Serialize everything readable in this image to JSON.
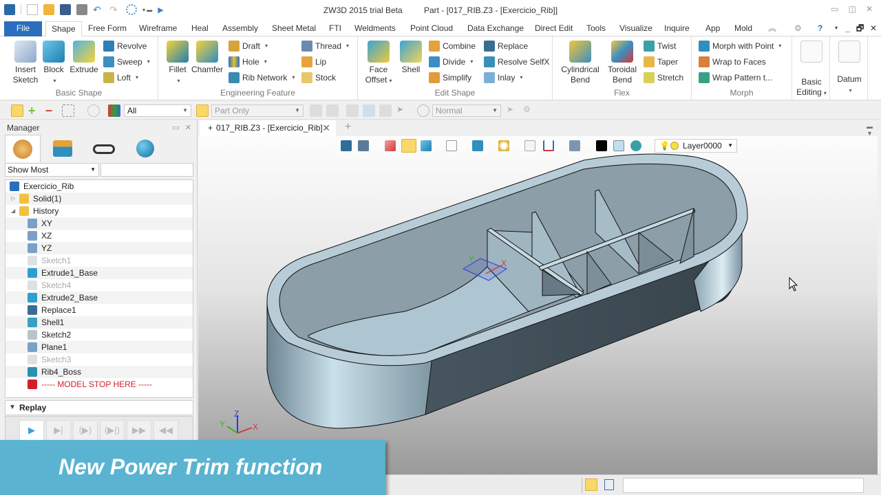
{
  "window": {
    "app_title": "ZW3D 2015 trial Beta",
    "doc_title": "Part - [017_RIB.Z3 - [Exercicio_Rib]]",
    "controls": [
      "minimize",
      "restore",
      "close"
    ]
  },
  "quick_access": [
    "app-logo-icon",
    "new-icon",
    "open-icon",
    "save-icon",
    "print-icon",
    "undo-icon",
    "redo-icon",
    "cycle-icon",
    "customize-icon",
    "play-icon"
  ],
  "ribbon_tabs": [
    "File",
    "Shape",
    "Free Form",
    "Wireframe",
    "Heal",
    "Assembly",
    "Sheet Metal",
    "FTI",
    "Weldments",
    "Point Cloud",
    "Data Exchange",
    "Direct Edit",
    "Tools",
    "Visualize",
    "Inquire",
    "App",
    "Mold"
  ],
  "active_tab": "Shape",
  "ribbon": {
    "basic_shape": {
      "label": "Basic Shape",
      "insert_sketch": "Insert Sketch",
      "block": "Block",
      "extrude": "Extrude",
      "revolve": "Revolve",
      "sweep": "Sweep",
      "loft": "Loft"
    },
    "engineering_feature": {
      "label": "Engineering Feature",
      "fillet": "Fillet",
      "chamfer": "Chamfer",
      "draft": "Draft",
      "hole": "Hole",
      "rib_network": "Rib Network",
      "thread": "Thread",
      "lip": "Lip",
      "stock": "Stock"
    },
    "edit_shape": {
      "label": "Edit Shape",
      "face_offset": "Face Offset",
      "shell": "Shell",
      "combine": "Combine",
      "divide": "Divide",
      "simplify": "Simplify",
      "replace": "Replace",
      "resolve_selfx": "Resolve SelfX",
      "inlay": "Inlay"
    },
    "flex": {
      "label": "Flex",
      "cylindrical_bend": "Cylindrical Bend",
      "toroidal_bend": "Toroidal Bend",
      "twist": "Twist",
      "taper": "Taper",
      "stretch": "Stretch"
    },
    "morph": {
      "label": "Morph",
      "morph_with_point": "Morph with Point",
      "wrap_to_faces": "Wrap to Faces",
      "wrap_pattern": "Wrap Pattern t..."
    },
    "basic_editing": "Basic Editing",
    "datum": "Datum"
  },
  "toolbar": {
    "filter_value": "All",
    "scope_value": "Part Only",
    "mode_value": "Normal"
  },
  "manager": {
    "title": "Manager",
    "filter_mode": "Show Most",
    "filter_text": "",
    "tree": [
      {
        "label": "Exercicio_Rib",
        "icon": "part-icon",
        "level": 0,
        "state": "normal"
      },
      {
        "label": "Solid(1)",
        "icon": "folder-icon",
        "level": 1,
        "state": "collapsed"
      },
      {
        "label": "History",
        "icon": "folder-open-icon",
        "level": 1,
        "state": "expanded"
      },
      {
        "label": "XY",
        "icon": "datum-plane-icon",
        "level": 2,
        "state": "normal"
      },
      {
        "label": "XZ",
        "icon": "datum-plane-icon",
        "level": 2,
        "state": "normal"
      },
      {
        "label": "YZ",
        "icon": "datum-plane-icon",
        "level": 2,
        "state": "normal"
      },
      {
        "label": "Sketch1",
        "icon": "sketch-icon",
        "level": 2,
        "state": "disabled"
      },
      {
        "label": "Extrude1_Base",
        "icon": "extrude-icon",
        "level": 2,
        "state": "normal"
      },
      {
        "label": "Sketch4",
        "icon": "sketch-icon",
        "level": 2,
        "state": "disabled"
      },
      {
        "label": "Extrude2_Base",
        "icon": "extrude-icon",
        "level": 2,
        "state": "normal"
      },
      {
        "label": "Replace1",
        "icon": "replace-icon",
        "level": 2,
        "state": "normal"
      },
      {
        "label": "Shell1",
        "icon": "shell-icon",
        "level": 2,
        "state": "normal"
      },
      {
        "label": "Sketch2",
        "icon": "sketch-icon",
        "level": 2,
        "state": "normal"
      },
      {
        "label": "Plane1",
        "icon": "datum-plane-icon",
        "level": 2,
        "state": "normal"
      },
      {
        "label": "Sketch3",
        "icon": "sketch-icon",
        "level": 2,
        "state": "disabled"
      },
      {
        "label": "Rib4_Boss",
        "icon": "rib-icon",
        "level": 2,
        "state": "normal"
      },
      {
        "label": "----- MODEL STOP HERE -----",
        "icon": "red-arrow-icon",
        "level": 2,
        "state": "stop"
      }
    ],
    "replay": {
      "title": "Replay",
      "buttons": [
        "play",
        "step-to-end",
        "play-next",
        "play-to-next",
        "fast-forward",
        "rewind"
      ]
    }
  },
  "document": {
    "tab_label": "017_RIB.Z3 - [Exercicio_Rib]",
    "layer": "Layer0000"
  },
  "caption": "New Power Trim function",
  "colors": {
    "file_tab": "#2a6ebd",
    "caption_bg": "#5ab3d0",
    "model_stop": "#d0202a",
    "model_face": "#a9c3cf"
  }
}
